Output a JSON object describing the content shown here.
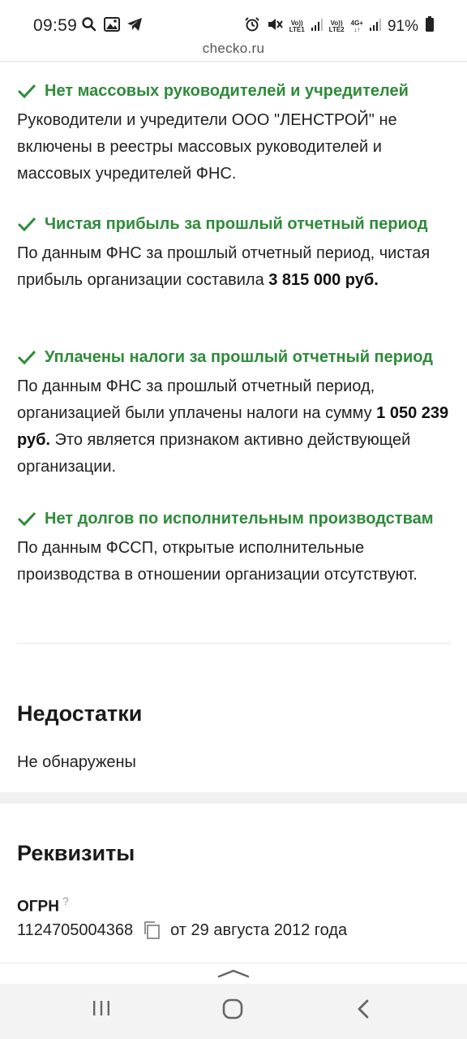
{
  "status_bar": {
    "time": "09:59",
    "battery_percent": "91%",
    "sim1_top": "Vo))",
    "sim1_bottom": "LTE1",
    "sim2_top": "Vo))",
    "sim2_bottom": "LTE2",
    "net_type": "4G+"
  },
  "browser": {
    "url": "checko.ru"
  },
  "checks": [
    {
      "title": "Нет массовых руководителей и учредителей",
      "text": "Руководители и учредители ООО \"ЛЕНСТРОЙ\" не включены в реестры массовых руководителей и массовых учредителей ФНС."
    },
    {
      "title": "Чистая прибыль за прошлый отчетный период",
      "text_before": "По данным ФНС за прошлый отчетный период, чистая прибыль организации составила ",
      "amount": "3 815 000 руб.",
      "text_after": ""
    },
    {
      "title": "Уплачены налоги за прошлый отчетный период",
      "text_before": "По данным ФНС за прошлый отчетный период, организацией были уплачены налоги на сумму ",
      "amount": "1 050 239 руб.",
      "text_after": " Это является признаком активно действующей организации."
    },
    {
      "title": "Нет долгов по исполнительным производствам",
      "text": "По данным ФССП, открытые исполнительные производства в отношении организации отсутствуют."
    }
  ],
  "shortcomings": {
    "title": "Недостатки",
    "text": "Не обнаружены"
  },
  "requisites": {
    "title": "Реквизиты",
    "ogrn_label": "ОГРН",
    "ogrn_help": "?",
    "ogrn_value": "1124705004368",
    "ogrn_date": "от 29 августа 2012 года"
  }
}
